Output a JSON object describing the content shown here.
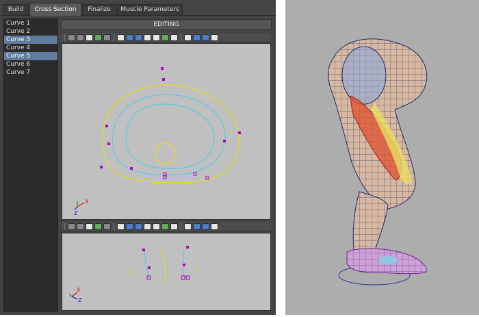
{
  "tabs": [
    {
      "label": "Build",
      "active": false
    },
    {
      "label": "Cross Section",
      "active": true
    },
    {
      "label": "Finalize",
      "active": false
    },
    {
      "label": "Muscle Parameters",
      "active": false
    }
  ],
  "curves": [
    {
      "label": "Curve 1",
      "selected": false
    },
    {
      "label": "Curve 2",
      "selected": false
    },
    {
      "label": "Curve 3",
      "selected": true
    },
    {
      "label": "Curve 4",
      "selected": false
    },
    {
      "label": "Curve 5",
      "selected": true
    },
    {
      "label": "Curve 6",
      "selected": false
    },
    {
      "label": "Curve 7",
      "selected": false
    }
  ],
  "editing_label": "EDITING",
  "toolbar_icons": [
    "camera-icon",
    "camera-attrs-icon",
    "bookmark-icon",
    "image-plane-icon",
    "grid-icon",
    "wireframe-icon",
    "smooth-shade-icon",
    "lighting-icon",
    "shadows-icon",
    "xray-icon",
    "isolate-icon",
    "texture-icon",
    "resolution-gate-icon",
    "perspective-icon",
    "ortho-icon",
    "camera-view-icon"
  ],
  "axis": {
    "x_label": "X",
    "z_label": "Z"
  },
  "colors": {
    "curve_yellow": "#e6dc1e",
    "curve_cyan": "#5ac8e6",
    "cv_magenta": "#b000c0",
    "selection_blue": "#5f7b9e",
    "viewport_bg": "#c0c0c0",
    "panel_bg": "#444444"
  }
}
